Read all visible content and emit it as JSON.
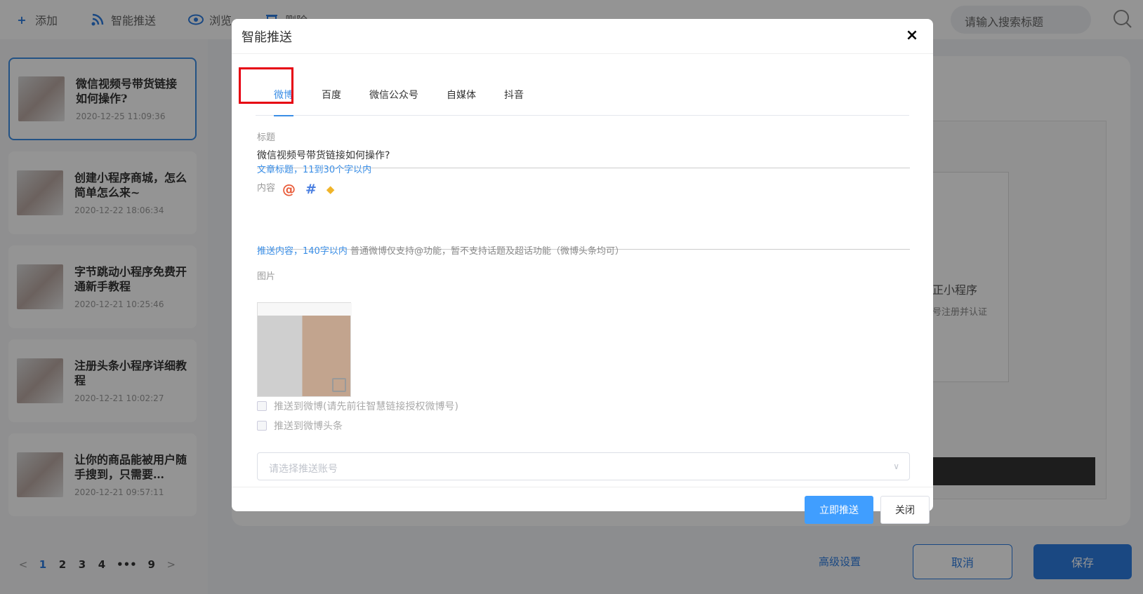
{
  "toolbar": {
    "add": "添加",
    "smart_push": "智能推送",
    "browse": "浏览",
    "delete": "删除",
    "search_placeholder": "请输入搜索标题"
  },
  "articles": [
    {
      "title": "微信视频号带货链接如何操作?",
      "date": "2020-12-25 11:09:36"
    },
    {
      "title": "创建小程序商城，怎么简单怎么来~",
      "date": "2020-12-22 18:06:34"
    },
    {
      "title": "字节跳动小程序免费开通新手教程",
      "date": "2020-12-21 10:25:46"
    },
    {
      "title": "注册头条小程序详细教程",
      "date": "2020-12-21 10:02:27"
    },
    {
      "title": "让你的商品能被用户随手搜到，只需要…",
      "date": "2020-12-21 09:57:11"
    }
  ],
  "pagination": {
    "prev": "<",
    "pages": [
      "1",
      "2",
      "3",
      "4",
      "•••",
      "9"
    ],
    "next": ">"
  },
  "background": {
    "text1": "正小程序",
    "text2": "号注册并认证",
    "advanced": "高级设置",
    "cancel": "取消",
    "save": "保存"
  },
  "modal": {
    "title": "智能推送",
    "close_icon": "×",
    "tabs": [
      "微博",
      "百度",
      "微信公众号",
      "自媒体",
      "抖音"
    ],
    "title_label": "标题",
    "title_value": "微信视频号带货链接如何操作?",
    "title_hint": "文章标题，11到30个字以内",
    "content_label": "内容",
    "content_icons": {
      "at": "@",
      "hash": "#",
      "diamond": "◆"
    },
    "content_hint_hl": "推送内容，140字以内",
    "content_hint": "普通微博仅支持@功能，暂不支持话题及超话功能（微博头条均可）",
    "image_label": "图片",
    "check1": "推送到微博(请先前往智慧链接授权微博号)",
    "check2": "推送到微博头条",
    "select_placeholder": "请选择推送账号",
    "push_button": "立即推送",
    "close_button": "关闭"
  },
  "colors": {
    "accent": "#409eff",
    "highlight_box": "#e60012"
  }
}
